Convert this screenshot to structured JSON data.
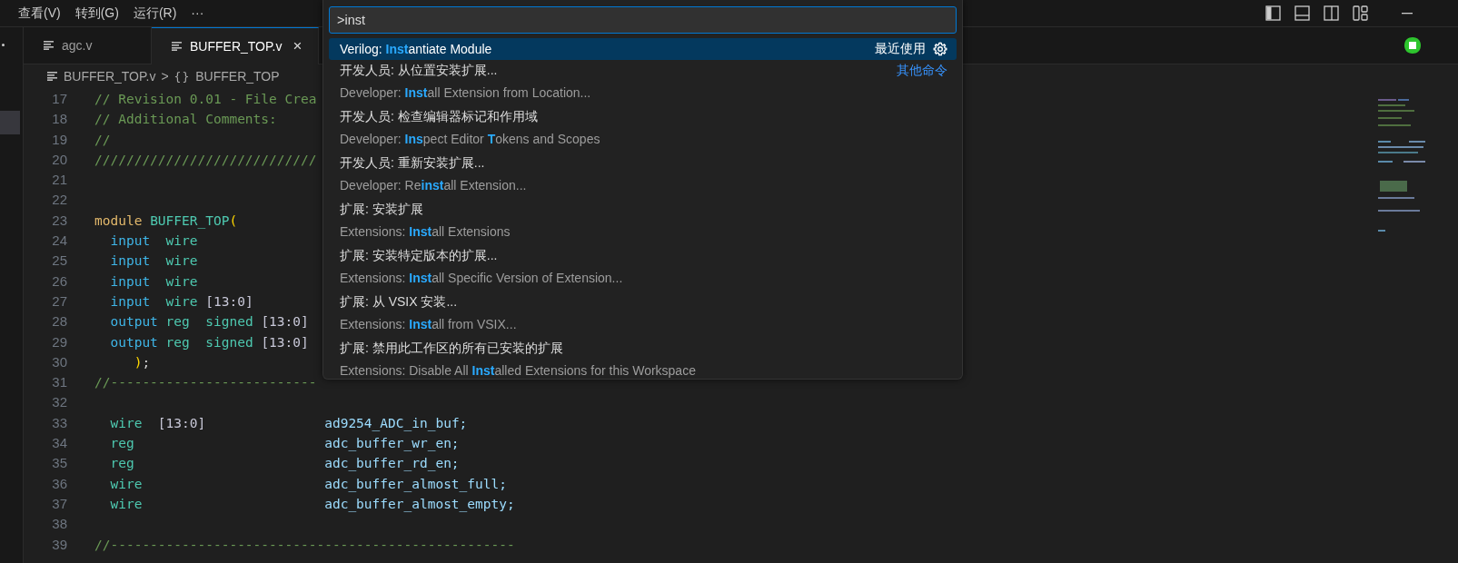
{
  "menu": [
    {
      "label": "查看(V)"
    },
    {
      "label": "转到(G)"
    },
    {
      "label": "运行(R)"
    },
    {
      "label": "···"
    }
  ],
  "tabs": [
    {
      "label": "agc.v",
      "selected": false
    },
    {
      "label": "BUFFER_TOP.v",
      "selected": true,
      "close": "×"
    }
  ],
  "breadcrumbs": {
    "file": "BUFFER_TOP.v",
    "separator": ">",
    "symbol_glyph": "{}",
    "symbol": "BUFFER_TOP"
  },
  "editor": {
    "lines": [
      {
        "number": "17",
        "tokens": [
          {
            "kind": "comment",
            "text": "// Revision 0.01 - File Crea"
          }
        ]
      },
      {
        "number": "18",
        "tokens": [
          {
            "kind": "comment",
            "text": "// Additional Comments:"
          }
        ]
      },
      {
        "number": "19",
        "tokens": [
          {
            "kind": "comment",
            "text": "//"
          }
        ]
      },
      {
        "number": "20",
        "tokens": [
          {
            "kind": "comment",
            "text": "////////////////////////////"
          }
        ]
      },
      {
        "number": "21"
      },
      {
        "number": "22"
      },
      {
        "number": "23",
        "tokens": [
          {
            "kind": "keyword",
            "text": "module"
          },
          {
            "kind": "type",
            "text": " BUFFER_TOP"
          },
          {
            "kind": "paren",
            "text": "("
          }
        ]
      },
      {
        "number": "24",
        "tokens": [
          {
            "kind": "port",
            "text": "  input"
          },
          {
            "kind": "type",
            "text": "  wire"
          }
        ]
      },
      {
        "number": "25",
        "tokens": [
          {
            "kind": "port",
            "text": "  input"
          },
          {
            "kind": "type",
            "text": "  wire"
          }
        ]
      },
      {
        "number": "26",
        "tokens": [
          {
            "kind": "port",
            "text": "  input"
          },
          {
            "kind": "type",
            "text": "  wire"
          }
        ]
      },
      {
        "number": "27",
        "tokens": [
          {
            "kind": "port",
            "text": "  input"
          },
          {
            "kind": "type",
            "text": "  wire"
          },
          {
            "kind": "range",
            "text": " [13:0]"
          }
        ]
      },
      {
        "number": "28",
        "tokens": [
          {
            "kind": "port",
            "text": "  output"
          },
          {
            "kind": "type",
            "text": " reg"
          },
          {
            "kind": "type",
            "text": "  signed"
          },
          {
            "kind": "range",
            "text": " [13:0]"
          }
        ]
      },
      {
        "number": "29",
        "tokens": [
          {
            "kind": "port",
            "text": "  output"
          },
          {
            "kind": "type",
            "text": " reg"
          },
          {
            "kind": "type",
            "text": "  signed"
          },
          {
            "kind": "range",
            "text": " [13:0]"
          }
        ]
      },
      {
        "number": "30",
        "tokens": [
          {
            "kind": "paren",
            "text": "     )"
          },
          {
            "kind": "punct",
            "text": ";"
          }
        ]
      },
      {
        "number": "31",
        "tokens": [
          {
            "kind": "comment",
            "text": "//--------------------------"
          }
        ]
      },
      {
        "number": "32"
      },
      {
        "number": "33",
        "tokens": [
          {
            "kind": "type",
            "text": "  wire"
          },
          {
            "kind": "range",
            "text": "  [13:0]"
          },
          {
            "kind": "ident",
            "text": "               ad9254_ADC_in_buf;"
          }
        ]
      },
      {
        "number": "34",
        "tokens": [
          {
            "kind": "type",
            "text": "  reg"
          },
          {
            "kind": "ident",
            "text": "                        adc_buffer_wr_en;"
          }
        ]
      },
      {
        "number": "35",
        "tokens": [
          {
            "kind": "type",
            "text": "  reg"
          },
          {
            "kind": "ident",
            "text": "                        adc_buffer_rd_en;"
          }
        ]
      },
      {
        "number": "36",
        "tokens": [
          {
            "kind": "type",
            "text": "  wire"
          },
          {
            "kind": "ident",
            "text": "                       adc_buffer_almost_full;"
          }
        ]
      },
      {
        "number": "37",
        "tokens": [
          {
            "kind": "type",
            "text": "  wire"
          },
          {
            "kind": "ident",
            "text": "                       adc_buffer_almost_empty;"
          }
        ]
      },
      {
        "number": "38"
      },
      {
        "number": "39",
        "tokens": [
          {
            "kind": "comment",
            "text": "//---------------------------------------------------"
          }
        ]
      }
    ]
  },
  "palette": {
    "input": ">inst",
    "items": [
      {
        "label": "Verilog: **Inst**antiate Module",
        "selected": true,
        "tag": "最近使用"
      },
      {
        "label": "开发人员: 从位置安装扩展...",
        "detail": "Developer: **Inst**all Extension from Location...",
        "selected": false,
        "link": "其他命令"
      },
      {
        "label": "开发人员: 检查编辑器标记和作用域",
        "detail": "Developer: **Ins**pect Editor **T**okens and Scopes",
        "selected": false
      },
      {
        "label": "开发人员: 重新安装扩展...",
        "detail": "Developer: Re**inst**all Extension...",
        "selected": false
      },
      {
        "label": "扩展: 安装扩展",
        "detail": "Extensions: **Inst**all Extensions",
        "selected": false
      },
      {
        "label": "扩展: 安装特定版本的扩展...",
        "detail": "Extensions: **Inst**all Specific Version of Extension...",
        "selected": false
      },
      {
        "label": "扩展: 从 VSIX 安装...",
        "detail": "Extensions: **Inst**all from VSIX...",
        "selected": false
      },
      {
        "label": "扩展: 禁用此工作区的所有已安装的扩展",
        "detail": "Extensions: Disable All **Inst**alled Extensions for this Workspace",
        "selected": false
      }
    ]
  }
}
